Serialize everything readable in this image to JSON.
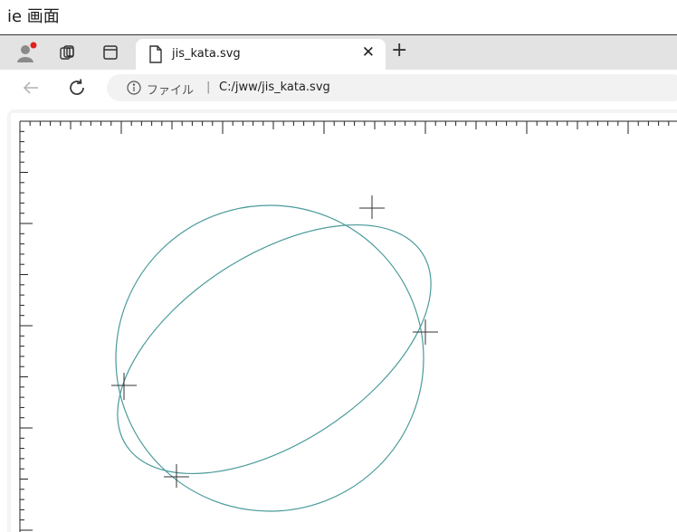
{
  "caption": "ie 画面",
  "tabs": [
    {
      "title": "jis_kata.svg",
      "close_label": "✕"
    }
  ],
  "new_tab_label": "+",
  "address_bar": {
    "scheme_label": "ファイル",
    "separator": "|",
    "url": "C:/jww/jis_kata.svg"
  },
  "colors": {
    "tabstrip": "#e3e3e3",
    "curve": "#4a9a9a",
    "marker": "#333333",
    "avatar_badge": "#e02020"
  },
  "icons": [
    "profile-icon",
    "workspaces-icon",
    "tab-actions-icon",
    "file-icon",
    "back-arrow-icon",
    "refresh-icon",
    "info-icon"
  ]
}
